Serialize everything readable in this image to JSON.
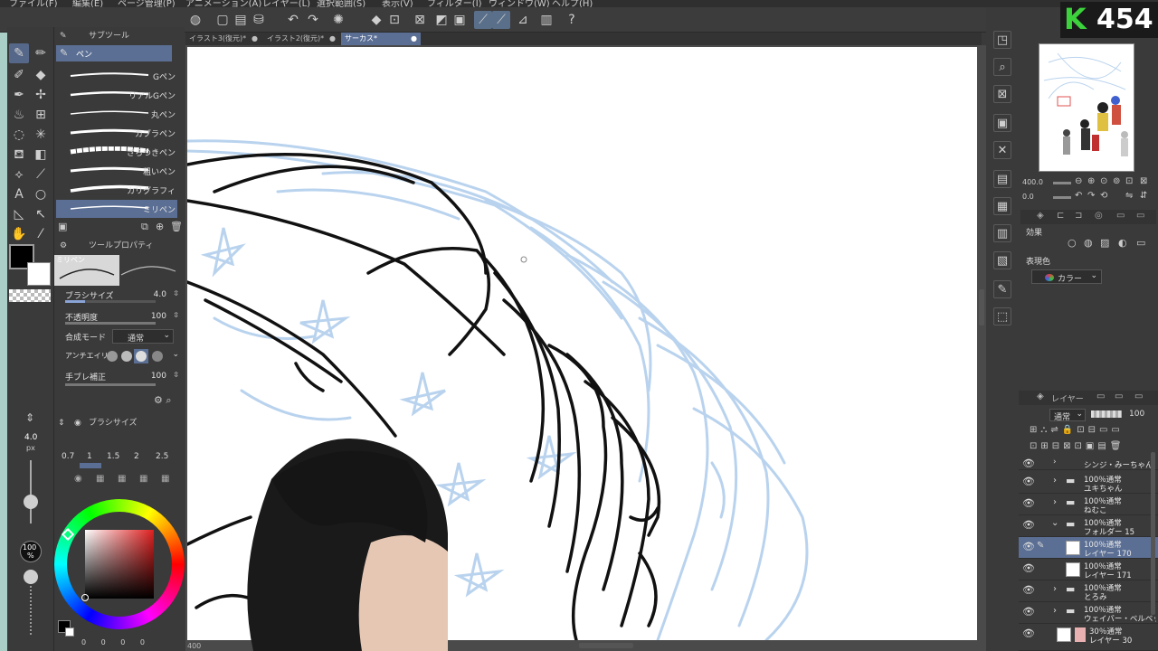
{
  "menu": [
    "ファイル(F)",
    "編集(E)",
    "ページ管理(P)",
    "アニメーション(A)",
    "レイヤー(L)",
    "選択範囲(S)",
    "表示(V)",
    "フィルター(I)",
    "ウィンドウ(W)",
    "ヘルプ(H)"
  ],
  "doc_tabs": [
    {
      "label": "イラスト3(復元)*"
    },
    {
      "label": "イラスト2(復元)*"
    },
    {
      "label": "サーカス*"
    }
  ],
  "subtool": {
    "tab_label": "サブツール",
    "group_label": "ペン",
    "brushes": [
      {
        "label": "Gペン"
      },
      {
        "label": "リアルGペン"
      },
      {
        "label": "丸ペン"
      },
      {
        "label": "カブラペン"
      },
      {
        "label": "ざらつきペン"
      },
      {
        "label": "粗いペン"
      },
      {
        "label": "カリグラフィ"
      },
      {
        "label": "ミリペン"
      }
    ]
  },
  "tool_property": {
    "tab_label": "ツールプロパティ",
    "preview_label": "ミリペン",
    "brush_size_label": "ブラシサイズ",
    "brush_size_value": "4.0",
    "opacity_label": "不透明度",
    "opacity_value": "100",
    "blend_label": "合成モード",
    "blend_value": "通常",
    "antialias_label": "アンチエイリアス",
    "stabilization_label": "手ブレ補正",
    "stabilization_value": "100"
  },
  "brush_size_panel": {
    "tab_label": "ブラシサイズ",
    "sizes": [
      "0.7",
      "1",
      "1.5",
      "2",
      "2.5"
    ]
  },
  "left_slider": {
    "size_value": "4.0",
    "size_unit": "px",
    "opacity_value": "100",
    "opacity_unit": "%"
  },
  "navigator": {
    "zoom_value": "400.0",
    "rotate_value": "0.0"
  },
  "properties": {
    "effect_label": "効果",
    "expression_label": "表現色",
    "expression_value": "カラー"
  },
  "layer_panel": {
    "tab_label": "レイヤー",
    "blend_mode": "通常",
    "opacity_value": "100",
    "layers": [
      {
        "line1": "シンジ・みーちゃん",
        "line2": "",
        "type": "folder"
      },
      {
        "line1": "100％通常",
        "line2": "ユキちゃん",
        "type": "folder"
      },
      {
        "line1": "100％通常",
        "line2": "ねむこ",
        "type": "folder"
      },
      {
        "line1": "100％通常",
        "line2": "フォルダー 15",
        "type": "folder"
      },
      {
        "line1": "100％通常",
        "line2": "レイヤー 170",
        "type": "raster",
        "selected": true
      },
      {
        "line1": "100％通常",
        "line2": "レイヤー 171",
        "type": "raster"
      },
      {
        "line1": "100％通常",
        "line2": "とろみ",
        "type": "folder"
      },
      {
        "line1": "100％通常",
        "line2": "ウェイバー・ベルベット",
        "type": "folder"
      },
      {
        "line1": "30％通常",
        "line2": "レイヤー 30",
        "type": "raster"
      }
    ]
  },
  "overlay": {
    "logo_letter": "K",
    "logo_number": "454"
  },
  "status": {
    "zoom": "400",
    "bottom_values": [
      "0",
      "0",
      "0",
      "0"
    ]
  },
  "colors": {
    "accent": "#5b6f94",
    "sketch_blue": "#b9d3ee",
    "line_black": "#111111",
    "logo_green": "#3cd23c"
  },
  "icons": [
    "pen-icon",
    "eraser-icon",
    "fill-icon",
    "lasso-icon",
    "text-icon",
    "hand-icon",
    "eyedropper-icon",
    "undo-icon",
    "redo-icon",
    "eye-icon",
    "folder-icon"
  ]
}
